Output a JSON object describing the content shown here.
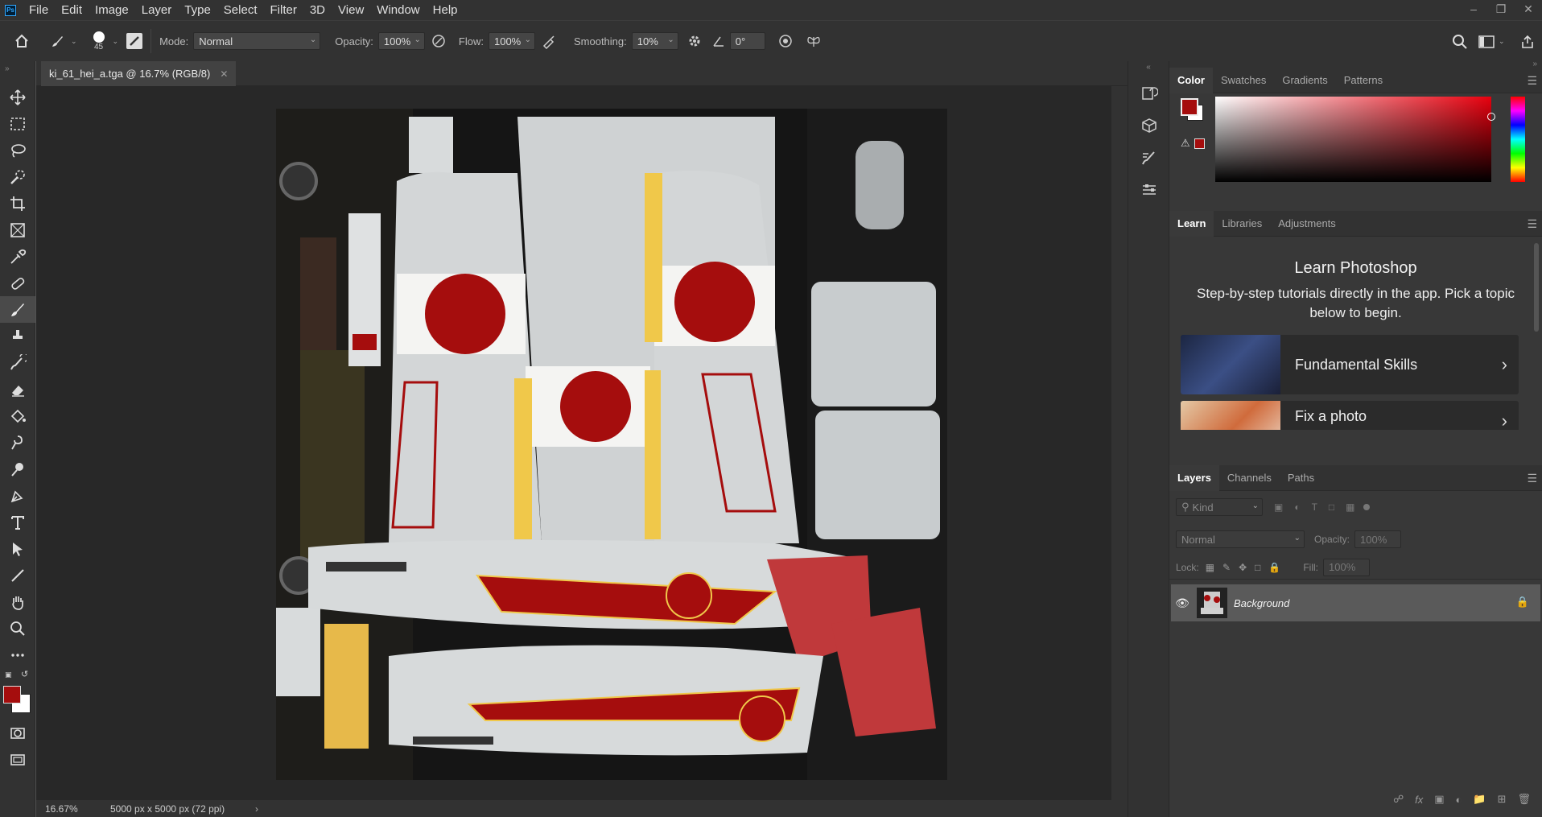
{
  "app": {
    "logo": "Ps"
  },
  "menubar": {
    "items": [
      "File",
      "Edit",
      "Image",
      "Layer",
      "Type",
      "Select",
      "Filter",
      "3D",
      "View",
      "Window",
      "Help"
    ]
  },
  "options": {
    "brush_size": "45",
    "mode_label": "Mode:",
    "mode_value": "Normal",
    "opacity_label": "Opacity:",
    "opacity_value": "100%",
    "flow_label": "Flow:",
    "flow_value": "100%",
    "smoothing_label": "Smoothing:",
    "smoothing_value": "10%",
    "angle_value": "0°"
  },
  "document": {
    "tab_title": "ki_61_hei_a.tga @ 16.7% (RGB/8)"
  },
  "status": {
    "zoom": "16.67%",
    "doc_info": "5000 px x 5000 px (72 ppi)",
    "arrow": "›"
  },
  "color_panel": {
    "tabs": [
      "Color",
      "Swatches",
      "Gradients",
      "Patterns"
    ],
    "foreground": "#a50d0d",
    "background": "#ffffff"
  },
  "learn_panel": {
    "tabs": [
      "Learn",
      "Libraries",
      "Adjustments"
    ],
    "title": "Learn Photoshop",
    "description": "Step-by-step tutorials directly in the app. Pick a topic below to begin.",
    "cards": [
      "Fundamental Skills",
      "Fix a photo"
    ]
  },
  "layers_panel": {
    "tabs": [
      "Layers",
      "Channels",
      "Paths"
    ],
    "filter_placeholder": "Kind",
    "blend_mode": "Normal",
    "opacity_label": "Opacity:",
    "opacity_value": "100%",
    "lock_label": "Lock:",
    "fill_label": "Fill:",
    "fill_value": "100%",
    "layers": [
      {
        "name": "Background",
        "visible": true,
        "locked": true
      }
    ]
  },
  "colors": {
    "accent_red": "#a50d0d",
    "panel_bg": "#383838",
    "chrome": "#323232"
  }
}
